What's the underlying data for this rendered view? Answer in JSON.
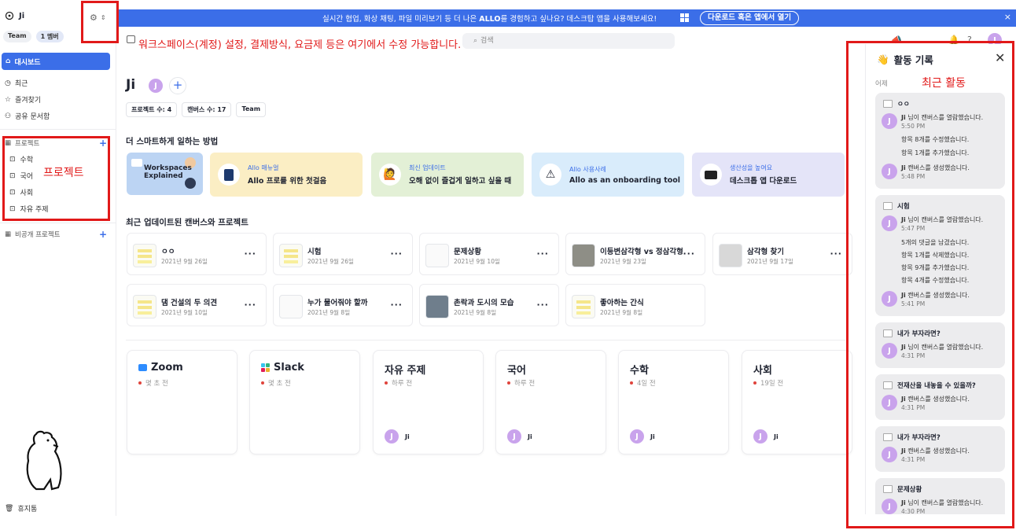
{
  "workspace": {
    "name": "Ji",
    "badge_type": "Team",
    "badge_members": "1 멤버"
  },
  "sidebar": {
    "dashboard": "대시보드",
    "recent": "최근",
    "favorites": "즐겨찾기",
    "shared": "공유 문서함",
    "projects_header": "프로젝트",
    "projects": [
      "수학",
      "국어",
      "사회",
      "자유 주제"
    ],
    "private_projects": "비공개 프로젝트",
    "trash": "휴지통"
  },
  "annotations": {
    "settings_note": "워크스페이스(계정) 설정, 결제방식, 요금제 등은 여기에서 수정 가능합니다.",
    "projects_note": "프로젝트",
    "activity_note": "최근 활동"
  },
  "banner": {
    "message_pre": "실시간 협업, 화상 채팅, 파일 미리보기 등 더 나은 ",
    "message_brand": "ALLO",
    "message_post": "를 경험하고 싶나요? 데스크탑 앱을 사용해보세요!",
    "button": "다운로드 혹은 앱에서 열기",
    "close": "×"
  },
  "search": {
    "text": "검색"
  },
  "main": {
    "title": "Ji",
    "avatar_letter": "J",
    "add": "+",
    "stats": [
      "프로젝트 수: 4",
      "캔버스 수: 17",
      "Team"
    ],
    "tips_title": "더 스마트하게 일하는 방법",
    "workspaces_thumb": "Workspaces Explained",
    "tips": [
      {
        "sub": "Allo 매뉴얼",
        "main": "Allo 프로를 위한 첫걸음",
        "icon": "book-icon",
        "bg": "#fbeec4"
      },
      {
        "sub": "최신 업데이트",
        "main": "오해 없이 즐겁게 일하고 싶을 때",
        "icon": "person-icon",
        "bg": "#e3f0d6"
      },
      {
        "sub": "Allo 사용사례",
        "main": "Allo as an onboarding tool",
        "icon": "warning-icon",
        "bg": "#d9ecfb"
      },
      {
        "sub": "생산성을 높여요",
        "main": "데스크톱 앱 다운로드",
        "icon": "monitor-icon",
        "bg": "#e4e4f8"
      }
    ],
    "recent_title": "최근 업데이트된 캔버스와 프로젝트",
    "canvases": [
      {
        "title": "ㅇㅇ",
        "date": "2021년 9월 26일"
      },
      {
        "title": "시험",
        "date": "2021년 9월 26일"
      },
      {
        "title": "문제상황",
        "date": "2021년 9월 10일"
      },
      {
        "title": "이등변삼각형 vs 정삼각형",
        "date": "2021년 9월 23일"
      },
      {
        "title": "삼각형 찾기",
        "date": "2021년 9월 17일"
      },
      {
        "title": "댐 건설의 두 의견",
        "date": "2021년 9월 10일"
      },
      {
        "title": "누가 물어줘야 할까",
        "date": "2021년 9월 8일"
      },
      {
        "title": "촌락과 도시의 모습",
        "date": "2021년 9월 8일"
      },
      {
        "title": "좋아하는 간식",
        "date": "2021년 9월 8일"
      }
    ],
    "projects": [
      {
        "name": "Zoom",
        "time": "몇 초 전",
        "owner": ""
      },
      {
        "name": "Slack",
        "time": "몇 초 전",
        "owner": ""
      },
      {
        "name": "자유 주제",
        "time": "하루 전",
        "owner": "Ji"
      },
      {
        "name": "국어",
        "time": "하루 전",
        "owner": "Ji"
      },
      {
        "name": "수학",
        "time": "4일 전",
        "owner": "Ji"
      },
      {
        "name": "사회",
        "time": "19일 전",
        "owner": "Ji"
      }
    ]
  },
  "activity": {
    "title": "활동 기록",
    "yesterday": "어제",
    "cards": [
      {
        "title": "ㅇㅇ",
        "e1": "님이 캔버스를 열람했습니다.",
        "t1": "5:50 PM",
        "s1": "항목 8개를 수정했습니다.",
        "s2": "항목 1개를 추가했습니다.",
        "e2": "캔버스를 생성했습니다.",
        "t2": "5:48 PM"
      },
      {
        "title": "시험",
        "e1": "님이 캔버스를 열람했습니다.",
        "t1": "5:47 PM",
        "s1": "5개의 댓글을 남겼습니다.",
        "s2": "항목 1개를 삭제했습니다.",
        "s3": "항목 9개를 추가했습니다.",
        "s4": "항목 4개를 수정했습니다.",
        "e2": "캔버스를 생성했습니다.",
        "t2": "5:41 PM"
      },
      {
        "title": "내가 부자라면?",
        "e1": "님이 캔버스를 열람했습니다.",
        "t1": "4:31 PM"
      },
      {
        "title": "전재산을 내놓을 수 있을까?",
        "e1": "캔버스를 생성했습니다.",
        "t1": "4:31 PM"
      },
      {
        "title": "내가 부자라면?",
        "e1": "캔버스를 생성했습니다.",
        "t1": "4:31 PM"
      },
      {
        "title": "문제상황",
        "e1": "님이 캔버스를 열람했습니다.",
        "t1": "4:30 PM"
      }
    ],
    "user": "Ji"
  }
}
